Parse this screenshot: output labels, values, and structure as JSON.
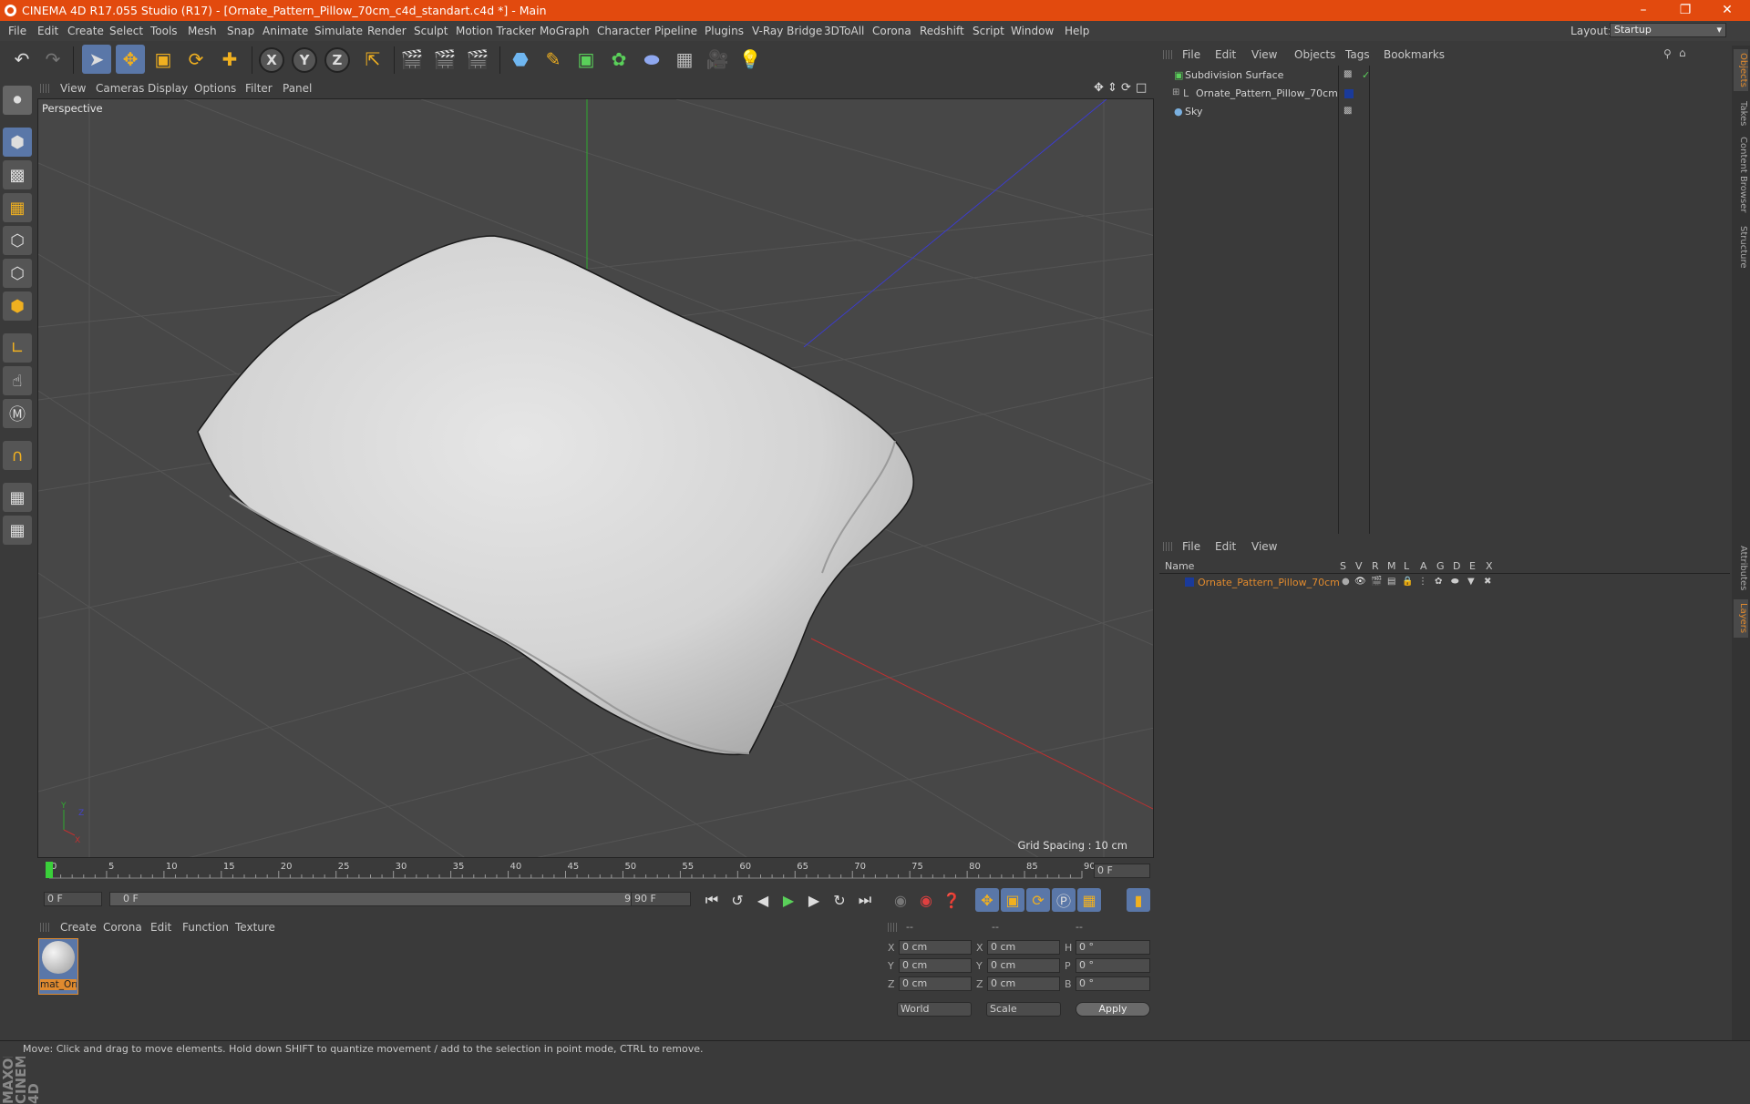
{
  "title": "CINEMA 4D R17.055 Studio (R17) - [Ornate_Pattern_Pillow_70cm_c4d_standart.c4d *] - Main",
  "menu": [
    "File",
    "Edit",
    "Create",
    "Select",
    "Tools",
    "Mesh",
    "Snap",
    "Animate",
    "Simulate",
    "Render",
    "Sculpt",
    "Motion Tracker",
    "MoGraph",
    "Character",
    "Pipeline",
    "Plugins",
    "V-Ray Bridge",
    "3DToAll",
    "Corona",
    "Redshift",
    "Script",
    "Window",
    "Help"
  ],
  "layout": {
    "label": "Layout:",
    "value": "Startup"
  },
  "viewport": {
    "menu": [
      "View",
      "Cameras",
      "Display",
      "Options",
      "Filter",
      "Panel"
    ],
    "label": "Perspective",
    "grid_spacing": "Grid Spacing : 10 cm"
  },
  "timeline": {
    "ticks": [
      "0",
      "5",
      "10",
      "15",
      "20",
      "25",
      "30",
      "35",
      "40",
      "45",
      "50",
      "55",
      "60",
      "65",
      "70",
      "75",
      "80",
      "85",
      "90"
    ],
    "current_frame": "0 F",
    "start": "0 F",
    "range_start": "0 F",
    "range_end": "90 F",
    "end": "90 F"
  },
  "material_manager": {
    "menu": [
      "Create",
      "Corona",
      "Edit",
      "Function",
      "Texture"
    ],
    "material_name": "mat_Orn"
  },
  "coordinates": {
    "headers": [
      "--",
      "--",
      "--"
    ],
    "rows": [
      {
        "a": "X",
        "av": "0 cm",
        "b": "X",
        "bv": "0 cm",
        "c": "H",
        "cv": "0 °"
      },
      {
        "a": "Y",
        "av": "0 cm",
        "b": "Y",
        "bv": "0 cm",
        "c": "P",
        "cv": "0 °"
      },
      {
        "a": "Z",
        "av": "0 cm",
        "b": "Z",
        "bv": "0 cm",
        "c": "B",
        "cv": "0 °"
      }
    ],
    "space": "World",
    "mode": "Scale",
    "apply": "Apply"
  },
  "object_manager": {
    "menu": [
      "File",
      "Edit",
      "View",
      "Objects",
      "Tags",
      "Bookmarks"
    ],
    "objects": [
      {
        "name": "Subdivision Surface"
      },
      {
        "name": "Ornate_Pattern_Pillow_70cm"
      },
      {
        "name": "Sky"
      }
    ]
  },
  "layer_manager": {
    "menu": [
      "File",
      "Edit",
      "View"
    ],
    "name_header": "Name",
    "columns": [
      "S",
      "V",
      "R",
      "M",
      "L",
      "A",
      "G",
      "D",
      "E",
      "X"
    ],
    "layer_name": "Ornate_Pattern_Pillow_70cm"
  },
  "side_tabs": [
    "Objects",
    "Takes",
    "Content Browser",
    "Structure",
    "Attributes",
    "Layers"
  ],
  "status": "Move: Click and drag to move elements. Hold down SHIFT to quantize movement / add to the selection in point mode, CTRL to remove.",
  "colors": {
    "title_bar": "#e24a0e",
    "accent": "#5a77a8",
    "layer_orange": "#e08a2e"
  }
}
